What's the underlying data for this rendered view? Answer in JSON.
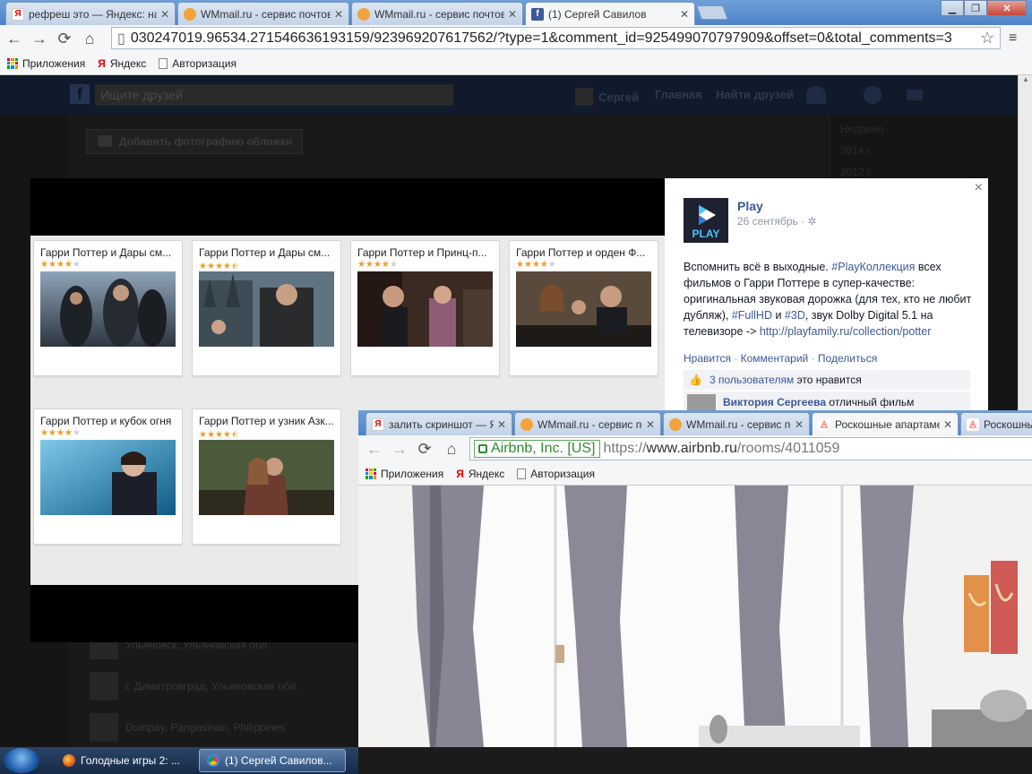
{
  "browser1": {
    "tabs": [
      {
        "favicon": "yandex",
        "title": "рефреш это — Яндекс: наш"
      },
      {
        "favicon": "wmmail",
        "title": "WMmail.ru - сервис почтовы"
      },
      {
        "favicon": "wmmail",
        "title": "WMmail.ru - сервис почтовы"
      },
      {
        "favicon": "facebook",
        "title": "(1) Сергей Савилов"
      }
    ],
    "url": "030247019.96534.271546636193159/923969207617562/?type=1&comment_id=925499070797909&offset=0&total_comments=3",
    "bookmarks": [
      {
        "icon": "apps-icon",
        "label": "Приложения"
      },
      {
        "icon": "yandex-icon",
        "label": "Яндекс"
      },
      {
        "icon": "page-icon",
        "label": "Авторизация"
      }
    ]
  },
  "facebook": {
    "search_placeholder": "Ищите друзей",
    "nav": {
      "user": "Сергей",
      "home": "Главная",
      "find_friends": "Найти друзей"
    },
    "add_cover": "Добавить фотографию обложки",
    "timeline": [
      "Недавно",
      "2014 г.",
      "2012 г."
    ],
    "locations": [
      {
        "text": "Ульяновск, Ульяновская обл."
      },
      {
        "text": "г. Димитровград, Ульяновская обл."
      },
      {
        "text": "Dumpay, Pangasinan, Philippines"
      }
    ]
  },
  "movies": [
    {
      "title": "Гарри Поттер и Дары см...",
      "rating": 4,
      "half": false
    },
    {
      "title": "Гарри Поттер и Дары см...",
      "rating": 4,
      "half": true
    },
    {
      "title": "Гарри Поттер и Принц-п...",
      "rating": 4,
      "half": false
    },
    {
      "title": "Гарри Поттер и орден Ф...",
      "rating": 4,
      "half": false
    },
    {
      "title": "Гарри Поттер и кубок огня",
      "rating": 4,
      "half": false
    },
    {
      "title": "Гарри Поттер и узник Азк...",
      "rating": 4,
      "half": true
    }
  ],
  "post": {
    "page_name": "Play",
    "logo_text": "PLAY",
    "date": "26 сентябрь ·",
    "text_1": "Вспомнить всё в выходные. ",
    "tag_1": "#PlayКоллекция",
    "text_2": " всех фильмов о Гарри Поттере в супер-качестве: оригинальная звуковая дорожка (для тех, кто не любит дубляж), ",
    "tag_2": "#FullHD",
    "text_3": " и ",
    "tag_3": "#3D",
    "text_4": ", звук Dolby Digital 5.1 на телевизоре -> ",
    "link": "http://playfamily.ru/collection/potter",
    "actions": {
      "like": "Нравится",
      "comment": "Комментарий",
      "share": "Поделиться"
    },
    "likes_link": "3 пользователям",
    "likes_text": "это нравится",
    "comment_author": "Виктория Сергеева",
    "comment_text": "отличный фильм",
    "close": "×"
  },
  "browser2": {
    "tabs": [
      {
        "favicon": "yandex",
        "title": "залить скриншот — Ян"
      },
      {
        "favicon": "wmmail",
        "title": "WMmail.ru - сервис поч"
      },
      {
        "favicon": "wmmail",
        "title": "WMmail.ru - сервис поч"
      },
      {
        "favicon": "airbnb",
        "title": "Роскошные апартаме"
      },
      {
        "favicon": "airbnb",
        "title": "Роскошны"
      }
    ],
    "ev_label": "Airbnb, Inc. [US]",
    "url_scheme": "https://",
    "url_host": "www.airbnb.ru",
    "url_path": "/rooms/4011059",
    "bookmarks": [
      {
        "icon": "apps-icon",
        "label": "Приложения"
      },
      {
        "icon": "yandex-icon",
        "label": "Яндекс"
      },
      {
        "icon": "page-icon",
        "label": "Авторизация"
      }
    ]
  },
  "taskbar": {
    "items": [
      {
        "icon": "firefox-icon",
        "label": "Голодные игры 2: ..."
      },
      {
        "icon": "chrome-icon",
        "label": "(1) Сергей Савилов..."
      }
    ]
  },
  "colors": {
    "facebook": "#3b5998",
    "star": "#f29b1d",
    "airbnb": "#ff5a5f",
    "play": "#4ec2ff"
  }
}
